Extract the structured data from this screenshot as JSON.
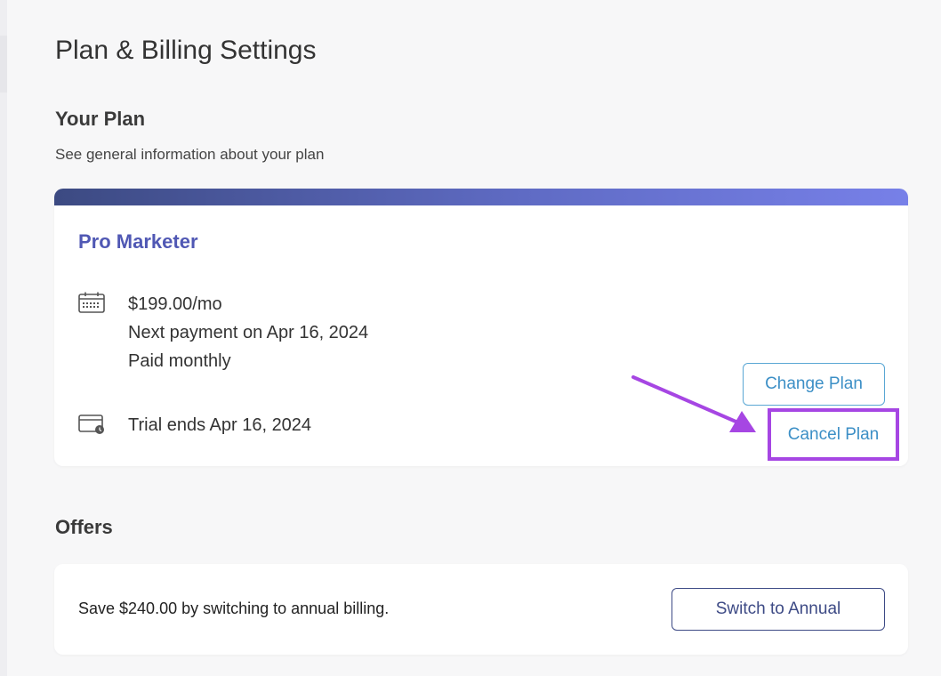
{
  "page": {
    "title": "Plan & Billing Settings"
  },
  "your_plan": {
    "heading": "Your Plan",
    "subtitle": "See general information about your plan",
    "plan_name": "Pro Marketer",
    "price": "$199.00/mo",
    "next_payment": "Next payment on Apr 16, 2024",
    "billing_cycle": "Paid monthly",
    "trial": "Trial ends Apr 16, 2024",
    "change_plan_label": "Change Plan",
    "cancel_plan_label": "Cancel Plan",
    "icons": [
      "calendar-icon",
      "card-clock-icon"
    ]
  },
  "offers": {
    "heading": "Offers",
    "text": "Save $240.00 by switching to annual billing.",
    "switch_label": "Switch to Annual"
  },
  "colors": {
    "plan_name": "#5058b4",
    "link_blue": "#3c8fc6",
    "highlight": "#a646e3",
    "gradient_start": "#3c4a82",
    "gradient_end": "#7780e8",
    "annual_button": "#3d4a85"
  }
}
